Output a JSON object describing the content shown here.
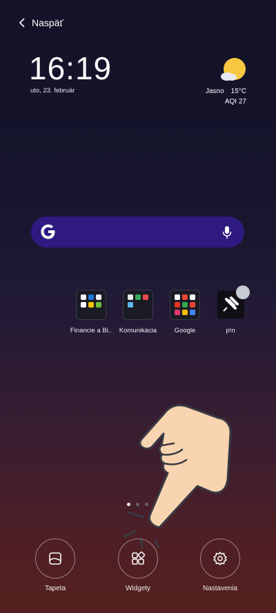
{
  "header": {
    "back_label": "Naspäť"
  },
  "clock": {
    "time": "16:19",
    "date": "uto, 23. február"
  },
  "weather": {
    "condition": "Jasno",
    "temperature": "15°C",
    "aqi": "AQI 27",
    "icon": "sun-cloud-icon"
  },
  "search": {
    "logo": "google-g-icon",
    "mic": "microphone-icon"
  },
  "folders": [
    {
      "label": "Financie a Bi..",
      "icon": "folder-icon"
    },
    {
      "label": "Komunikácia",
      "icon": "folder-icon"
    },
    {
      "label": "Google",
      "icon": "folder-icon"
    },
    {
      "label": "p!n",
      "icon": "pin-icon"
    }
  ],
  "page_indicator": {
    "count": 3,
    "active": 1
  },
  "actions": [
    {
      "label": "Tapeta",
      "icon": "wallpaper-icon"
    },
    {
      "label": "Widgety",
      "icon": "widgets-icon"
    },
    {
      "label": "Nastavenia",
      "icon": "gear-icon"
    }
  ],
  "colors": {
    "search_bar": "#2e1a80",
    "hand": "#f8d5b0"
  }
}
